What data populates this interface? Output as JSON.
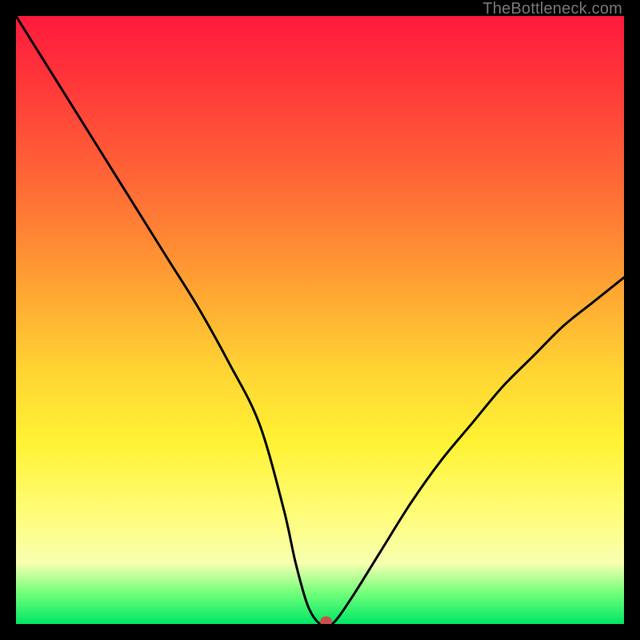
{
  "watermark": "TheBottleneck.com",
  "chart_data": {
    "type": "line",
    "title": "",
    "xlabel": "",
    "ylabel": "",
    "xlim": [
      0,
      100
    ],
    "ylim": [
      0,
      100
    ],
    "grid": false,
    "legend": false,
    "annotations": [],
    "x": [
      0,
      5,
      10,
      15,
      20,
      25,
      30,
      35,
      40,
      44,
      46,
      48,
      50,
      52,
      55,
      60,
      65,
      70,
      75,
      80,
      85,
      90,
      95,
      100
    ],
    "values": [
      100,
      92,
      84,
      76,
      68,
      60,
      52,
      43,
      33,
      19,
      10,
      3,
      0,
      0,
      4,
      12,
      20,
      27,
      33,
      39,
      44,
      49,
      53,
      57
    ],
    "marker": {
      "x": 51,
      "y": 0
    }
  }
}
